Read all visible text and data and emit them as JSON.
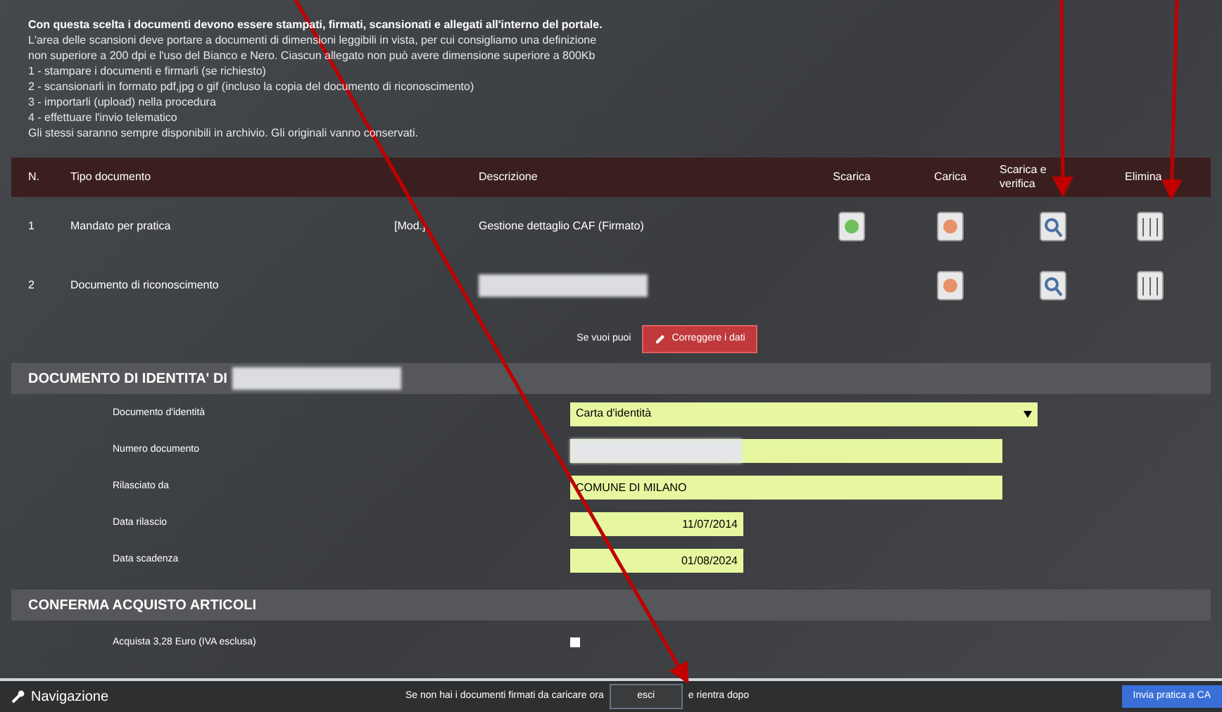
{
  "intro": {
    "heading": "Con questa scelta i documenti devono essere stampati, firmati, scansionati e allegati all'interno del portale.",
    "lines": [
      "L'area delle scansioni deve portare a documenti di dimensioni leggibili in vista, per cui consigliamo una definizione",
      "non superiore a 200 dpi e l'uso del Bianco e Nero. Ciascun allegato non può avere dimensione superiore a 800Kb",
      "1 - stampare i documenti e firmarli (se richiesto)",
      "2 - scansionarli in formato pdf,jpg o gif (incluso la copia del documento di riconoscimento)",
      "3 - importarli (upload) nella procedura",
      "4 - effettuare l'invio telematico",
      "Gli stessi saranno sempre disponibili in archivio. Gli originali vanno conservati."
    ]
  },
  "table": {
    "columns": [
      "N.",
      "Tipo documento",
      "Descrizione",
      "Scarica",
      "Carica",
      "Scarica e verifica",
      "Elimina"
    ],
    "rows": [
      {
        "number": "1",
        "type": "Mandato per pratica",
        "tag": "[Mod.]",
        "description": "Gestione dettaglio CAF (Firmato)",
        "redacted": false,
        "download": true,
        "upload": true,
        "verify": true,
        "delete": true
      },
      {
        "number": "2",
        "type": "Documento di riconoscimento",
        "tag": "",
        "description": "",
        "redacted": true,
        "download": false,
        "upload": true,
        "verify": true,
        "delete": true
      }
    ]
  },
  "correct": {
    "label": "Se vuoi puoi",
    "button": "Correggere i dati"
  },
  "identity": {
    "title": "DOCUMENTO DI IDENTITA' DI",
    "fields": [
      {
        "kind": "select",
        "label": "Documento d'identità",
        "value": "Carta d'identità"
      },
      {
        "kind": "redacted",
        "label": "Numero documento"
      },
      {
        "kind": "text",
        "label": "Rilasciato da",
        "value": "COMUNE DI MILANO"
      },
      {
        "kind": "date",
        "label": "Data rilascio",
        "value": "11/07/2014"
      },
      {
        "kind": "date",
        "label": "Data scadenza",
        "value": "01/08/2024"
      }
    ]
  },
  "purchase": {
    "title": "CONFERMA ACQUISTO ARTICOLI",
    "label": "Acquista 3,28 Euro (IVA esclusa)",
    "checked": false
  },
  "footer": {
    "navigation": "Navigazione",
    "prefix": "Se non hai i documenti firmati da caricare ora",
    "button": "esci",
    "suffix": "e rientra dopo",
    "send": "Invia pratica a CA"
  }
}
